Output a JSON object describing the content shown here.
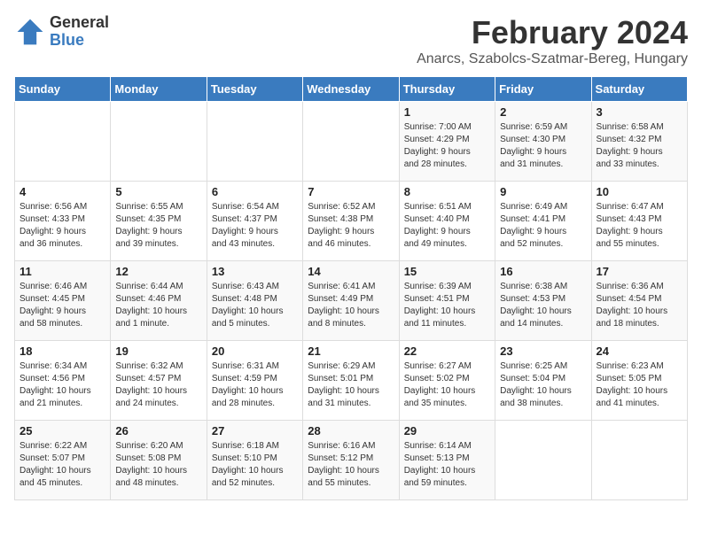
{
  "header": {
    "logo_general": "General",
    "logo_blue": "Blue",
    "title": "February 2024",
    "subtitle": "Anarcs, Szabolcs-Szatmar-Bereg, Hungary"
  },
  "days_of_week": [
    "Sunday",
    "Monday",
    "Tuesday",
    "Wednesday",
    "Thursday",
    "Friday",
    "Saturday"
  ],
  "weeks": [
    [
      {
        "day": "",
        "info": ""
      },
      {
        "day": "",
        "info": ""
      },
      {
        "day": "",
        "info": ""
      },
      {
        "day": "",
        "info": ""
      },
      {
        "day": "1",
        "info": "Sunrise: 7:00 AM\nSunset: 4:29 PM\nDaylight: 9 hours\nand 28 minutes."
      },
      {
        "day": "2",
        "info": "Sunrise: 6:59 AM\nSunset: 4:30 PM\nDaylight: 9 hours\nand 31 minutes."
      },
      {
        "day": "3",
        "info": "Sunrise: 6:58 AM\nSunset: 4:32 PM\nDaylight: 9 hours\nand 33 minutes."
      }
    ],
    [
      {
        "day": "4",
        "info": "Sunrise: 6:56 AM\nSunset: 4:33 PM\nDaylight: 9 hours\nand 36 minutes."
      },
      {
        "day": "5",
        "info": "Sunrise: 6:55 AM\nSunset: 4:35 PM\nDaylight: 9 hours\nand 39 minutes."
      },
      {
        "day": "6",
        "info": "Sunrise: 6:54 AM\nSunset: 4:37 PM\nDaylight: 9 hours\nand 43 minutes."
      },
      {
        "day": "7",
        "info": "Sunrise: 6:52 AM\nSunset: 4:38 PM\nDaylight: 9 hours\nand 46 minutes."
      },
      {
        "day": "8",
        "info": "Sunrise: 6:51 AM\nSunset: 4:40 PM\nDaylight: 9 hours\nand 49 minutes."
      },
      {
        "day": "9",
        "info": "Sunrise: 6:49 AM\nSunset: 4:41 PM\nDaylight: 9 hours\nand 52 minutes."
      },
      {
        "day": "10",
        "info": "Sunrise: 6:47 AM\nSunset: 4:43 PM\nDaylight: 9 hours\nand 55 minutes."
      }
    ],
    [
      {
        "day": "11",
        "info": "Sunrise: 6:46 AM\nSunset: 4:45 PM\nDaylight: 9 hours\nand 58 minutes."
      },
      {
        "day": "12",
        "info": "Sunrise: 6:44 AM\nSunset: 4:46 PM\nDaylight: 10 hours\nand 1 minute."
      },
      {
        "day": "13",
        "info": "Sunrise: 6:43 AM\nSunset: 4:48 PM\nDaylight: 10 hours\nand 5 minutes."
      },
      {
        "day": "14",
        "info": "Sunrise: 6:41 AM\nSunset: 4:49 PM\nDaylight: 10 hours\nand 8 minutes."
      },
      {
        "day": "15",
        "info": "Sunrise: 6:39 AM\nSunset: 4:51 PM\nDaylight: 10 hours\nand 11 minutes."
      },
      {
        "day": "16",
        "info": "Sunrise: 6:38 AM\nSunset: 4:53 PM\nDaylight: 10 hours\nand 14 minutes."
      },
      {
        "day": "17",
        "info": "Sunrise: 6:36 AM\nSunset: 4:54 PM\nDaylight: 10 hours\nand 18 minutes."
      }
    ],
    [
      {
        "day": "18",
        "info": "Sunrise: 6:34 AM\nSunset: 4:56 PM\nDaylight: 10 hours\nand 21 minutes."
      },
      {
        "day": "19",
        "info": "Sunrise: 6:32 AM\nSunset: 4:57 PM\nDaylight: 10 hours\nand 24 minutes."
      },
      {
        "day": "20",
        "info": "Sunrise: 6:31 AM\nSunset: 4:59 PM\nDaylight: 10 hours\nand 28 minutes."
      },
      {
        "day": "21",
        "info": "Sunrise: 6:29 AM\nSunset: 5:01 PM\nDaylight: 10 hours\nand 31 minutes."
      },
      {
        "day": "22",
        "info": "Sunrise: 6:27 AM\nSunset: 5:02 PM\nDaylight: 10 hours\nand 35 minutes."
      },
      {
        "day": "23",
        "info": "Sunrise: 6:25 AM\nSunset: 5:04 PM\nDaylight: 10 hours\nand 38 minutes."
      },
      {
        "day": "24",
        "info": "Sunrise: 6:23 AM\nSunset: 5:05 PM\nDaylight: 10 hours\nand 41 minutes."
      }
    ],
    [
      {
        "day": "25",
        "info": "Sunrise: 6:22 AM\nSunset: 5:07 PM\nDaylight: 10 hours\nand 45 minutes."
      },
      {
        "day": "26",
        "info": "Sunrise: 6:20 AM\nSunset: 5:08 PM\nDaylight: 10 hours\nand 48 minutes."
      },
      {
        "day": "27",
        "info": "Sunrise: 6:18 AM\nSunset: 5:10 PM\nDaylight: 10 hours\nand 52 minutes."
      },
      {
        "day": "28",
        "info": "Sunrise: 6:16 AM\nSunset: 5:12 PM\nDaylight: 10 hours\nand 55 minutes."
      },
      {
        "day": "29",
        "info": "Sunrise: 6:14 AM\nSunset: 5:13 PM\nDaylight: 10 hours\nand 59 minutes."
      },
      {
        "day": "",
        "info": ""
      },
      {
        "day": "",
        "info": ""
      }
    ]
  ]
}
